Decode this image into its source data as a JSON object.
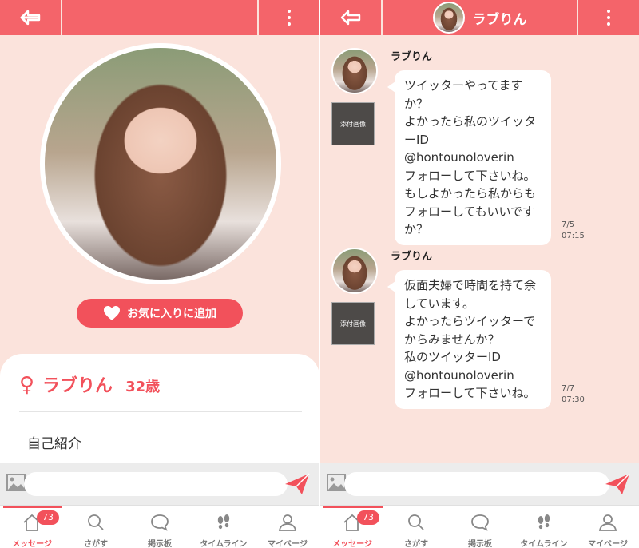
{
  "colors": {
    "header": "#f4646a",
    "accent": "#f2515b",
    "background": "#fbe3dc"
  },
  "profile": {
    "name": "ラブりん",
    "age": "32歳",
    "gender_symbol": "♀",
    "favorite_button_label": "お気に入りに追加",
    "intro_heading": "自己紹介"
  },
  "chat": {
    "title": "ラブりん",
    "messages": [
      {
        "sender": "ラブりん",
        "attachment_label": "添付画像",
        "lines": [
          "ツイッターやってます",
          "か？",
          "よかったら私のツイッタ",
          "ーID",
          "@hontounoloverin",
          "フォローして下さいね。",
          "もしよかったら私からも",
          "フォローしてもいいです",
          "か？"
        ],
        "date": "7/5",
        "time": "07:15"
      },
      {
        "sender": "ラブりん",
        "attachment_label": "添付画像",
        "lines": [
          "仮面夫婦で時間を持て余",
          "しています。",
          "よかったらツイッターで",
          "からみませんか？",
          "私のツイッターID",
          "@hontounoloverin",
          "フォローして下さいね。"
        ],
        "date": "7/7",
        "time": "07:30"
      }
    ]
  },
  "tabbar": {
    "badge": "73",
    "tabs": [
      {
        "label": "メッセージ",
        "icon": "home-icon"
      },
      {
        "label": "さがす",
        "icon": "search-icon"
      },
      {
        "label": "掲示板",
        "icon": "speech-bubble-icon"
      },
      {
        "label": "タイムライン",
        "icon": "footprints-icon"
      },
      {
        "label": "マイページ",
        "icon": "person-icon"
      }
    ]
  }
}
